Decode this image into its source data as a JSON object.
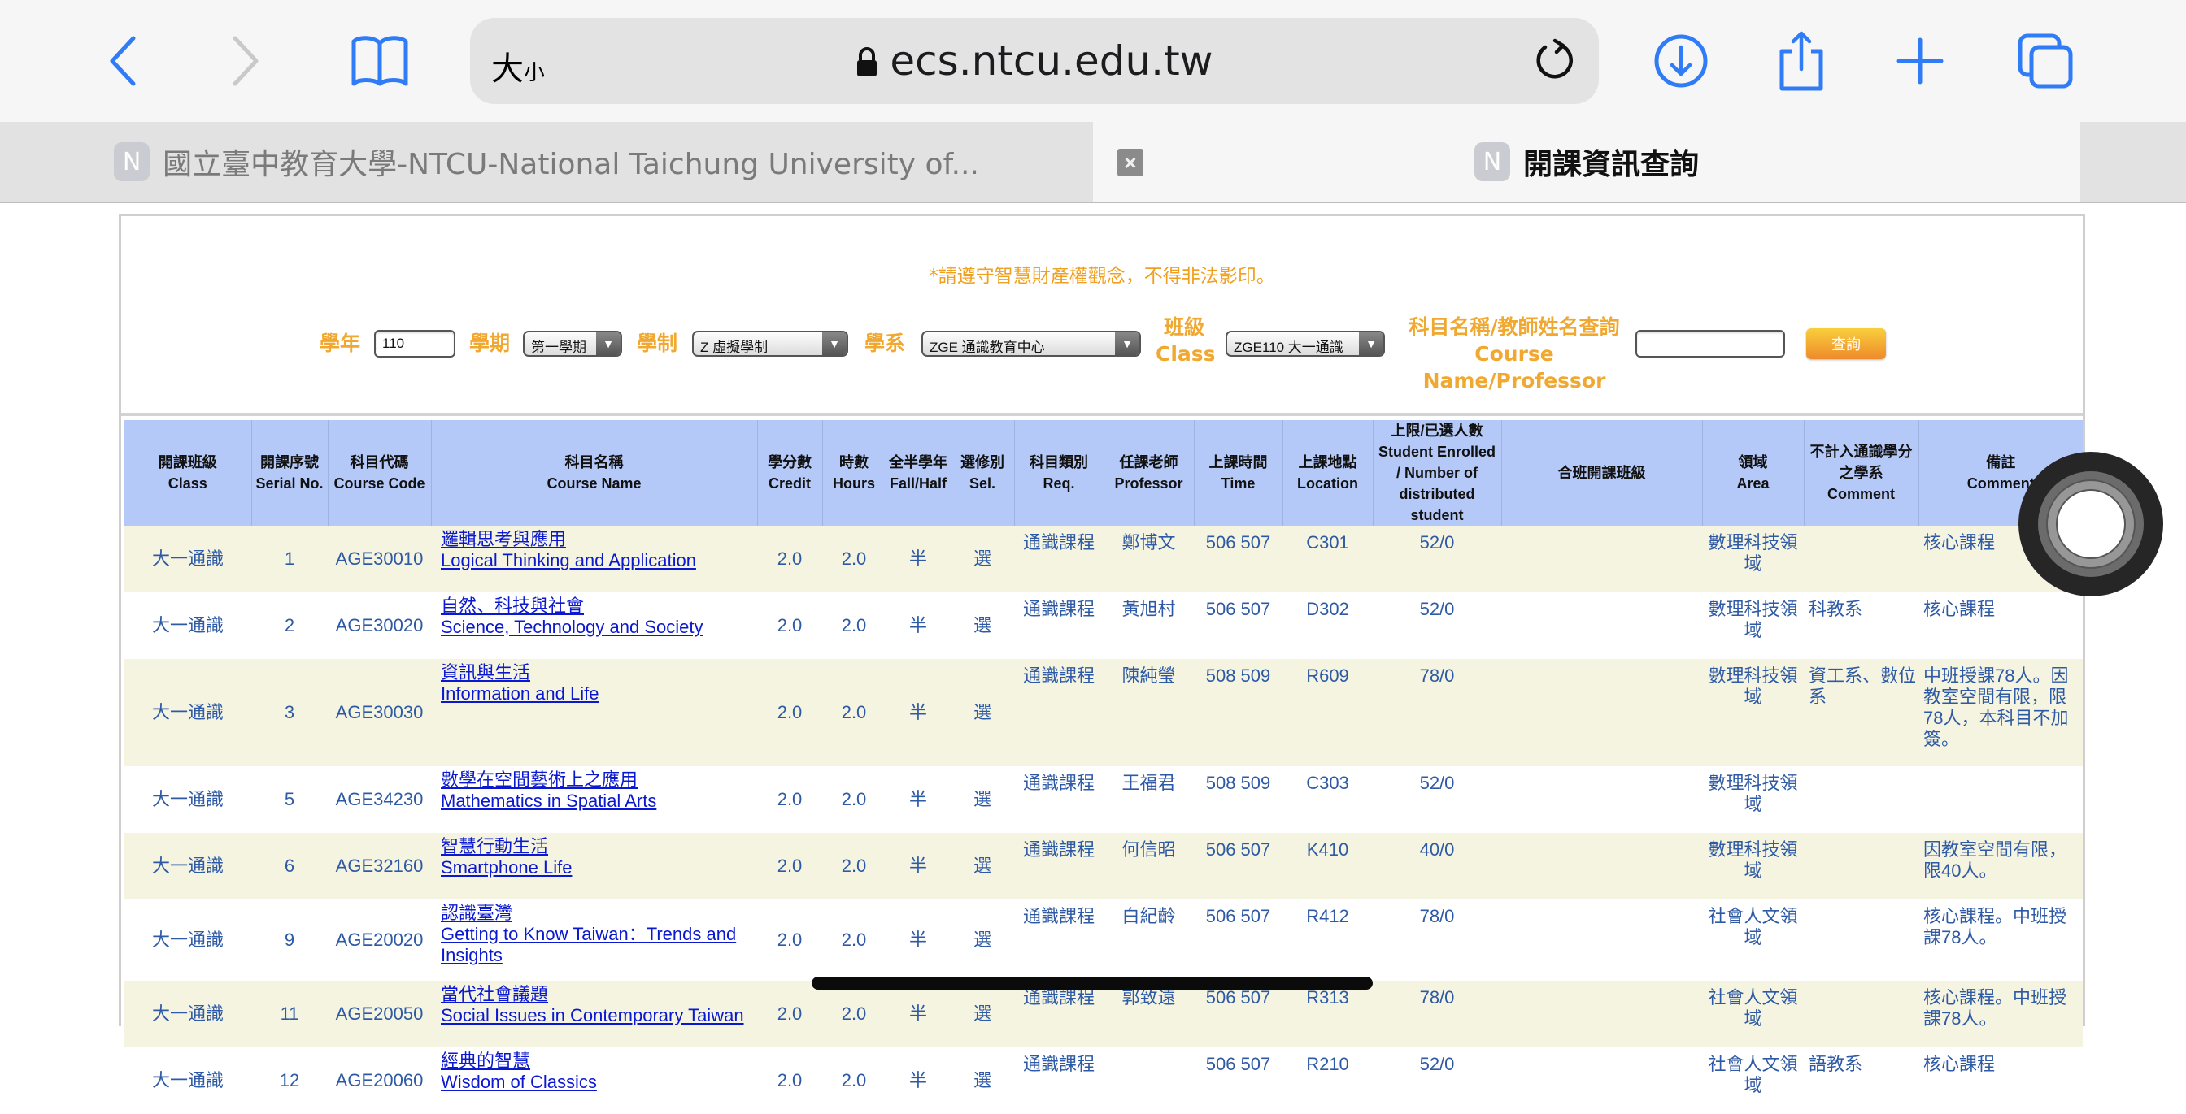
{
  "browser": {
    "text_size_label_big": "大",
    "text_size_label_small": "小",
    "url": "ecs.ntcu.edu.tw",
    "tabs": [
      {
        "favicon": "N",
        "title": "國立臺中教育大學-NTCU-National Taichung University of...",
        "active": false
      },
      {
        "favicon": "N",
        "title": "開課資訊查詢",
        "active": true
      }
    ],
    "tab_close_glyph": "×"
  },
  "search": {
    "notice": "*請遵守智慧財產權觀念，不得非法影印。",
    "year_label": "學年",
    "year_value": "110",
    "semester_label": "學期",
    "semester_value": "第一學期",
    "system_label": "學制",
    "system_value": "Z 虛擬學制",
    "dept_label": "學系",
    "dept_value": "ZGE 通識教育中心",
    "class_label_zh": "班級",
    "class_label_en": "Class",
    "class_value": "ZGE110 大一通識",
    "query_label_zh": "科目名稱/教師姓名查詢",
    "query_label_en": "Course Name/Professor",
    "query_value": "",
    "search_button": "查詢"
  },
  "table": {
    "headers": [
      {
        "zh": "開課班級",
        "en": "Class"
      },
      {
        "zh": "開課序號",
        "en": "Serial No."
      },
      {
        "zh": "科目代碼",
        "en": "Course Code"
      },
      {
        "zh": "科目名稱",
        "en": "Course Name"
      },
      {
        "zh": "學分數",
        "en": "Credit"
      },
      {
        "zh": "時數",
        "en": "Hours"
      },
      {
        "zh": "全半學年",
        "en": "Fall/Half"
      },
      {
        "zh": "選修別",
        "en": "Sel."
      },
      {
        "zh": "科目類別",
        "en": "Req."
      },
      {
        "zh": "任課老師",
        "en": "Professor"
      },
      {
        "zh": "上課時間",
        "en": "Time"
      },
      {
        "zh": "上課地點",
        "en": "Location"
      },
      {
        "zh": "上限/已選人數",
        "en": "Student Enrolled / Number of distributed student"
      },
      {
        "zh": "合班開課班級",
        "en": ""
      },
      {
        "zh": "領域",
        "en": "Area"
      },
      {
        "zh": "不計入通識學分之學系",
        "en": "Comment"
      },
      {
        "zh": "備註",
        "en": "Comment"
      }
    ],
    "rows": [
      {
        "class": "大一通識",
        "serial": "1",
        "code": "AGE30010",
        "name_zh": "邏輯思考與應用",
        "name_en": "Logical Thinking and Application",
        "credit": "2.0",
        "hours": "2.0",
        "half": "半",
        "sel": "選",
        "req": "通識課程",
        "professor": "鄭博文",
        "time": "506 507",
        "location": "C301",
        "enrolled": "52/0",
        "combined": "",
        "area": "數理科技領域",
        "no_credit_dept": "",
        "comment": "核心課程"
      },
      {
        "class": "大一通識",
        "serial": "2",
        "code": "AGE30020",
        "name_zh": "自然、科技與社會",
        "name_en": "Science, Technology and Society",
        "credit": "2.0",
        "hours": "2.0",
        "half": "半",
        "sel": "選",
        "req": "通識課程",
        "professor": "黃旭村",
        "time": "506 507",
        "location": "D302",
        "enrolled": "52/0",
        "combined": "",
        "area": "數理科技領域",
        "no_credit_dept": "科教系",
        "comment": "核心課程"
      },
      {
        "class": "大一通識",
        "serial": "3",
        "code": "AGE30030",
        "name_zh": "資訊與生活",
        "name_en": "Information and Life",
        "credit": "2.0",
        "hours": "2.0",
        "half": "半",
        "sel": "選",
        "req": "通識課程",
        "professor": "陳純瑩",
        "time": "508 509",
        "location": "R609",
        "enrolled": "78/0",
        "combined": "",
        "area": "數理科技領域",
        "no_credit_dept": "資工系、數位系",
        "comment": "中班授課78人。因教室空間有限，限78人，本科目不加簽。"
      },
      {
        "class": "大一通識",
        "serial": "5",
        "code": "AGE34230",
        "name_zh": "數學在空間藝術上之應用",
        "name_en": "Mathematics in Spatial Arts",
        "credit": "2.0",
        "hours": "2.0",
        "half": "半",
        "sel": "選",
        "req": "通識課程",
        "professor": "王福君",
        "time": "508 509",
        "location": "C303",
        "enrolled": "52/0",
        "combined": "",
        "area": "數理科技領域",
        "no_credit_dept": "",
        "comment": ""
      },
      {
        "class": "大一通識",
        "serial": "6",
        "code": "AGE32160",
        "name_zh": "智慧行動生活",
        "name_en": "Smartphone Life",
        "credit": "2.0",
        "hours": "2.0",
        "half": "半",
        "sel": "選",
        "req": "通識課程",
        "professor": "何信昭",
        "time": "506 507",
        "location": "K410",
        "enrolled": "40/0",
        "combined": "",
        "area": "數理科技領域",
        "no_credit_dept": "",
        "comment": "因教室空間有限，限40人。"
      },
      {
        "class": "大一通識",
        "serial": "9",
        "code": "AGE20020",
        "name_zh": "認識臺灣",
        "name_en": "Getting to Know Taiwan：Trends and Insights",
        "credit": "2.0",
        "hours": "2.0",
        "half": "半",
        "sel": "選",
        "req": "通識課程",
        "professor": "白紀齡",
        "time": "506 507",
        "location": "R412",
        "enrolled": "78/0",
        "combined": "",
        "area": "社會人文領域",
        "no_credit_dept": "",
        "comment": "核心課程。中班授課78人。"
      },
      {
        "class": "大一通識",
        "serial": "11",
        "code": "AGE20050",
        "name_zh": "當代社會議題",
        "name_en": "Social Issues in Contemporary Taiwan",
        "credit": "2.0",
        "hours": "2.0",
        "half": "半",
        "sel": "選",
        "req": "通識課程",
        "professor": "郭致遠",
        "time": "506 507",
        "location": "R313",
        "enrolled": "78/0",
        "combined": "",
        "area": "社會人文領域",
        "no_credit_dept": "",
        "comment": "核心課程。中班授課78人。"
      },
      {
        "class": "大一通識",
        "serial": "12",
        "code": "AGE20060",
        "name_zh": "經典的智慧",
        "name_en": "Wisdom of Classics",
        "credit": "2.0",
        "hours": "2.0",
        "half": "半",
        "sel": "選",
        "req": "通識課程",
        "professor": "",
        "time": "506 507",
        "location": "R210",
        "enrolled": "52/0",
        "combined": "",
        "area": "社會人文領域",
        "no_credit_dept": "語教系",
        "comment": "核心課程"
      }
    ]
  }
}
